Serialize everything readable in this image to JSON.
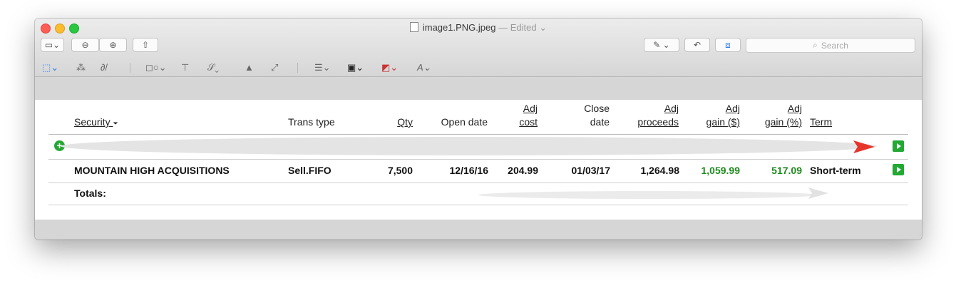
{
  "window": {
    "filename": "image1.PNG.jpeg",
    "status": "— Edited",
    "status_chevron": "⌄"
  },
  "toolbar": {
    "search_placeholder": "Search",
    "icons": [
      "sidebar-icon",
      "zoom-out-icon",
      "zoom-in-icon",
      "share-icon",
      "pen-icon",
      "rotate-icon",
      "toolbox-icon"
    ]
  },
  "table": {
    "headers": {
      "security": "Security",
      "sort_indicator": "⏷",
      "trans_type": "Trans type",
      "qty": "Qty",
      "open_date": "Open date",
      "adj_cost_1": "Adj",
      "adj_cost_2": "cost",
      "close_date_1": "Close",
      "close_date_2": "date",
      "adj_proceeds_1": "Adj",
      "adj_proceeds_2": "proceeds",
      "adj_gain_d_1": "Adj",
      "adj_gain_d_2": "gain ($)",
      "adj_gain_p_1": "Adj",
      "adj_gain_p_2": "gain (%)",
      "term": "Term"
    },
    "row": {
      "security": "MOUNTAIN HIGH ACQUISITIONS",
      "trans_type": "Sell.FIFO",
      "qty": "7,500",
      "open_date": "12/16/16",
      "adj_cost": "204.99",
      "close_date": "01/03/17",
      "adj_proceeds": "1,264.98",
      "adj_gain_d": "1,059.99",
      "adj_gain_p": "517.09",
      "term": "Short-term"
    },
    "totals_label": "Totals:"
  },
  "colors": {
    "gain": "#1e8a1e",
    "action": "#22a833"
  }
}
